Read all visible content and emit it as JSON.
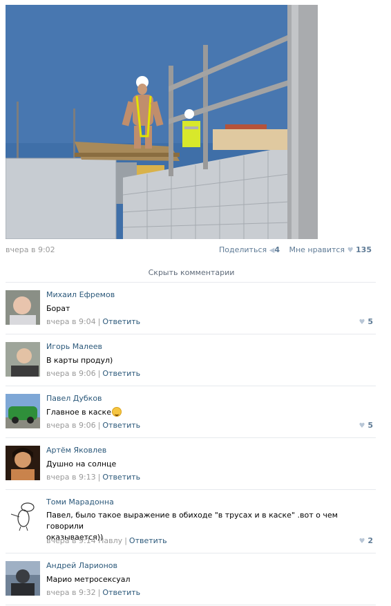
{
  "post": {
    "time": "вчера в 9:02",
    "share_label": "Поделиться",
    "share_count": "4",
    "like_label": "Мне нравится",
    "like_count": "135"
  },
  "hide_comments_label": "Скрыть комментарии",
  "comments": [
    {
      "author": "Михаил Ефремов",
      "text": "Борат",
      "time": "вчера в 9:04",
      "reply_label": "Ответить",
      "likes": "5"
    },
    {
      "author": "Игорь Малеев",
      "text": "В карты продул)",
      "time": "вчера в 9:06",
      "reply_label": "Ответить",
      "likes": ""
    },
    {
      "author": "Павел Дубков",
      "text": "Главное в каске",
      "time": "вчера в 9:06",
      "reply_label": "Ответить",
      "likes": "5"
    },
    {
      "author": "Артём Яковлев",
      "text": "Душно на солнце",
      "time": "вчера в 9:13",
      "reply_label": "Ответить",
      "likes": ""
    },
    {
      "author": "Томи Марадонна",
      "text_line1": "Павел, было такое выражение в обиходе \"в трусах и в каске\" .вот о чем говорили",
      "text_line2": "оказывается))",
      "time": "вчера в 9:14 Павлу",
      "reply_label": "Ответить",
      "likes": "2"
    },
    {
      "author": "Андрей Ларионов",
      "text": "Марио метросексуал",
      "time": "вчера в 9:32",
      "reply_label": "Ответить",
      "likes": ""
    }
  ],
  "icons": {
    "heart": "heart-icon",
    "share": "megaphone-icon",
    "emoji": "laughing-emoji-icon"
  },
  "colors": {
    "link": "#2b587a",
    "muted": "#999999",
    "like": "#5f7b96"
  }
}
